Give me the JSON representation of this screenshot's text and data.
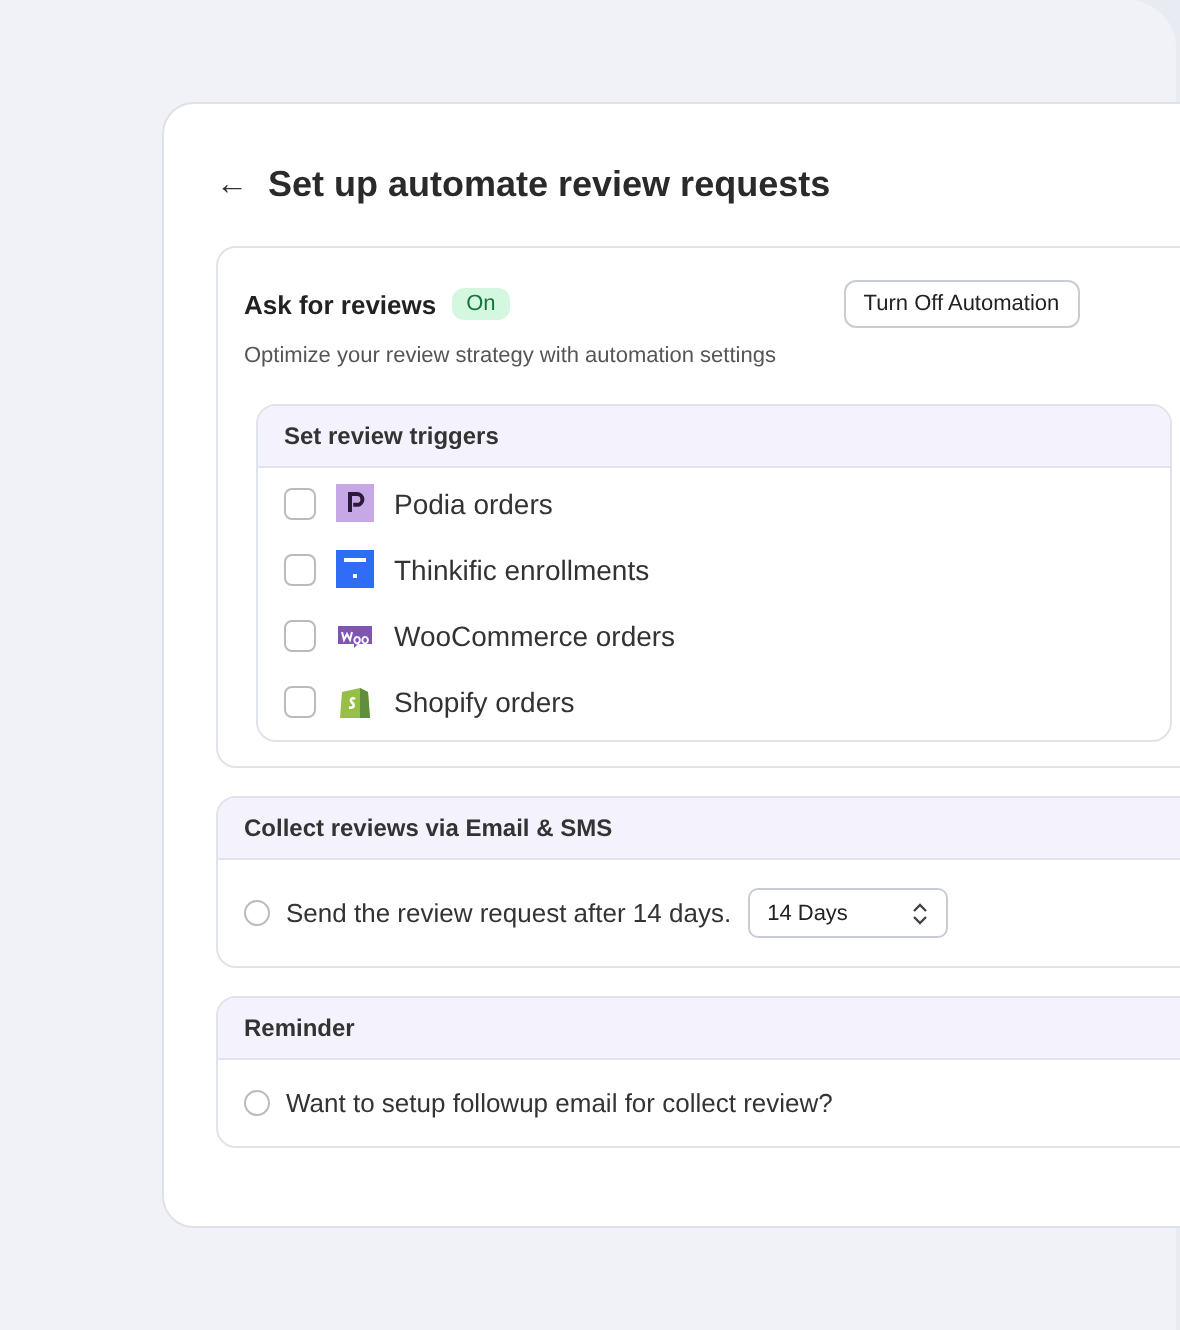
{
  "header": {
    "back_icon": "←",
    "title": "Set up automate review requests"
  },
  "ask_section": {
    "title": "Ask for reviews",
    "status": "On",
    "on": true,
    "button": "Turn Off Automation",
    "description": "Optimize your review strategy with automation settings",
    "triggers": {
      "title": "Set review triggers",
      "items": [
        {
          "label": "Podia orders",
          "checked": false,
          "kind": "letter"
        },
        {
          "label": "Thinkific enrollments",
          "checked": false,
          "kind": "bar"
        },
        {
          "label": "WooCommerce orders",
          "checked": false,
          "kind": "bubble"
        },
        {
          "label": "Shopify orders",
          "checked": false,
          "kind": "bag"
        }
      ]
    }
  },
  "collect_section": {
    "title": "Collect reviews via Email & SMS",
    "option": {
      "label": "Send the review request after 14 days.",
      "selected": false
    },
    "select": {
      "value": "14 Days"
    }
  },
  "reminder_section": {
    "title": "Reminder",
    "option": {
      "label": "Want to setup followup email for collect review?",
      "selected": false
    }
  }
}
